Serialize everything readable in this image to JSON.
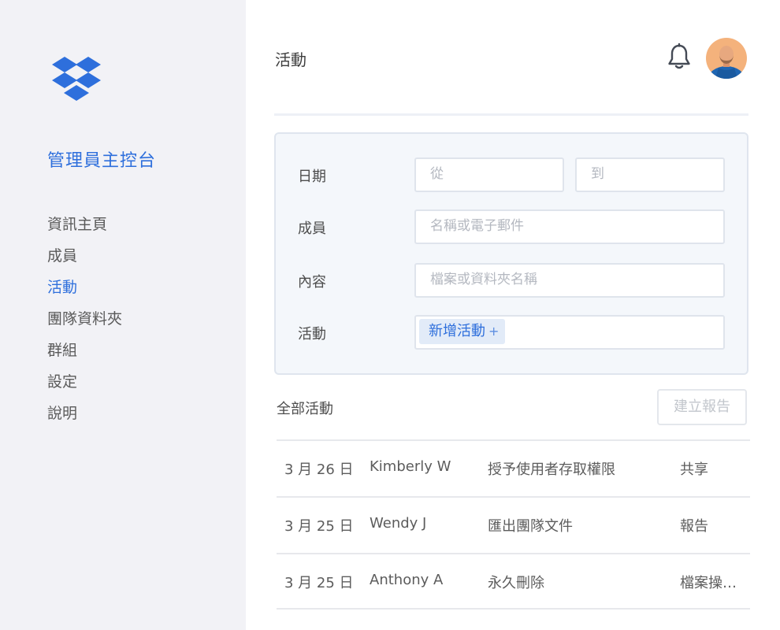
{
  "sidebar": {
    "console_title": "管理員主控台",
    "nav": [
      {
        "label": "資訊主頁",
        "active": false
      },
      {
        "label": "成員",
        "active": false
      },
      {
        "label": "活動",
        "active": true
      },
      {
        "label": "團隊資料夾",
        "active": false
      },
      {
        "label": "群組",
        "active": false
      },
      {
        "label": "設定",
        "active": false
      },
      {
        "label": "說明",
        "active": false
      }
    ]
  },
  "header": {
    "title": "活動"
  },
  "filters": {
    "date_label": "日期",
    "date_from_placeholder": "從",
    "date_to_placeholder": "到",
    "member_label": "成員",
    "member_placeholder": "名稱或電子郵件",
    "content_label": "內容",
    "content_placeholder": "檔案或資料夾名稱",
    "activity_label": "活動",
    "activity_tag": "新增活動",
    "activity_tag_plus": "+"
  },
  "activity_list": {
    "title": "全部活動",
    "create_report_label": "建立報告",
    "rows": [
      {
        "date": "3 月 26 日",
        "member": "Kimberly W",
        "action": "授予使用者存取權限",
        "type": "共享"
      },
      {
        "date": "3 月 25 日",
        "member": "Wendy J",
        "action": "匯出團隊文件",
        "type": "報告"
      },
      {
        "date": "3 月 25 日",
        "member": "Anthony A",
        "action": "永久刪除",
        "type": "檔案操…"
      }
    ]
  },
  "colors": {
    "accent": "#2e6fdc",
    "sidebar_bg": "#f2f2f6",
    "panel_bg": "#f4f7fb"
  }
}
